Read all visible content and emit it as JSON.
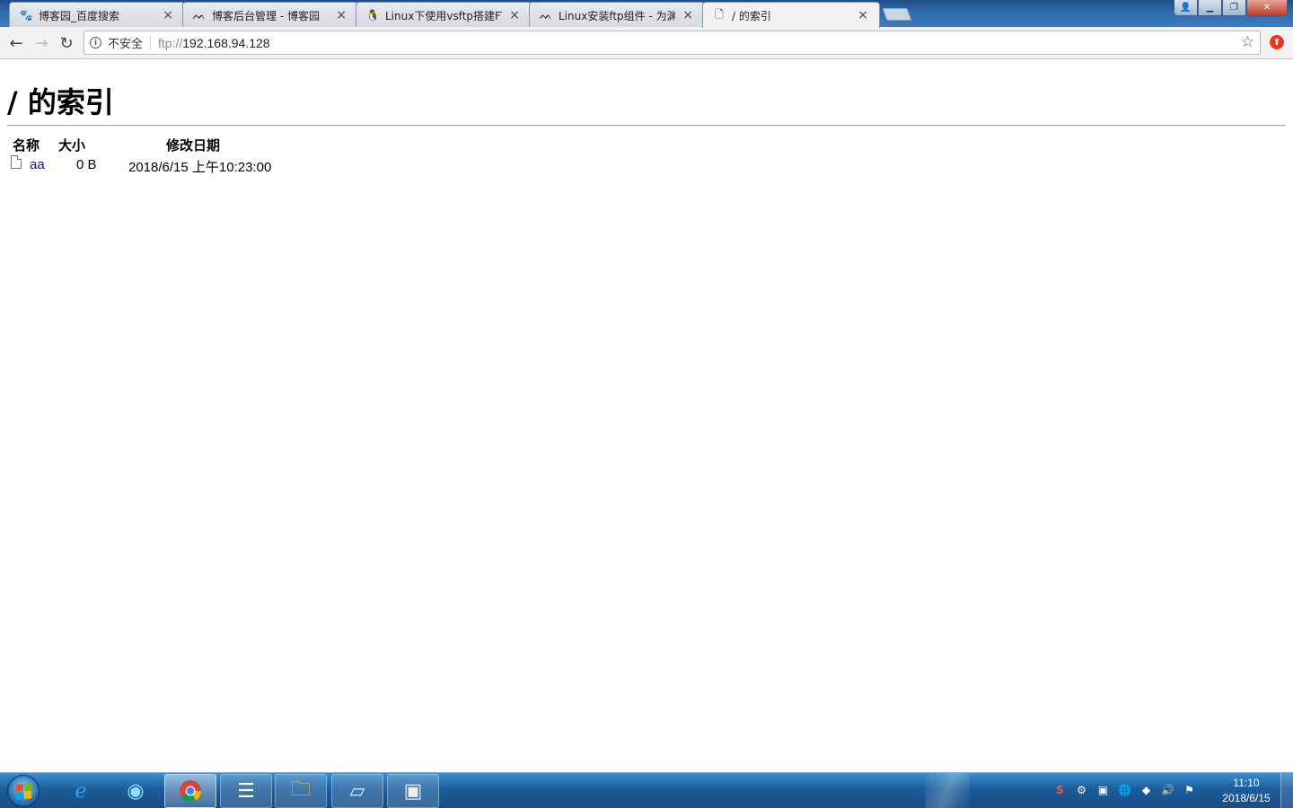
{
  "browser": {
    "tabs": [
      {
        "title": "博客园_百度搜索",
        "icon": "baidu-paw-icon"
      },
      {
        "title": "博客后台管理 - 博客园",
        "icon": "cnblogs-icon"
      },
      {
        "title": "Linux下使用vsftp搭建FT",
        "icon": "tux-penguin-icon"
      },
      {
        "title": "Linux安装ftp组件 - 为渊",
        "icon": "cnblogs-icon"
      },
      {
        "title": "/ 的索引",
        "icon": "document-icon"
      }
    ],
    "security_label": "不安全",
    "url_prefix": "ftp://",
    "url_host": "192.168.94.128"
  },
  "page": {
    "heading": "/ 的索引",
    "columns": {
      "name": "名称",
      "size": "大小",
      "modified": "修改日期"
    },
    "entries": [
      {
        "name": "aa",
        "size": "0 B",
        "modified": "2018/6/15 上午10:23:00"
      }
    ]
  },
  "taskbar": {
    "apps": [
      "internet-explorer-icon",
      "edge-icon",
      "chrome-icon",
      "file-list-icon",
      "folder-icon",
      "notepad-icon",
      "media-icon"
    ],
    "clock": {
      "time": "11:10",
      "date": "2018/6/15"
    }
  },
  "colors": {
    "link": "#1a0dab",
    "taskbar": "#1c5d9c"
  }
}
